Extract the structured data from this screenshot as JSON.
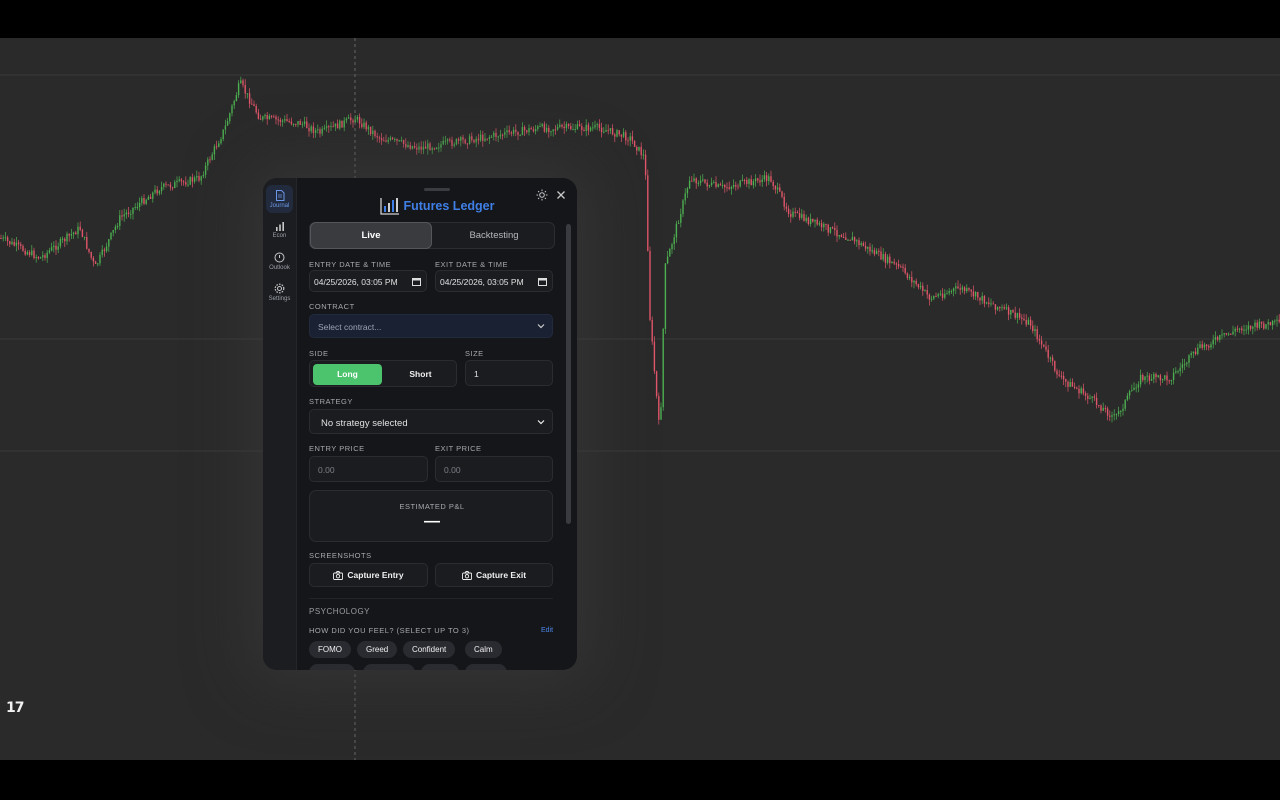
{
  "chart": {
    "logo": "17"
  },
  "panel": {
    "brand_title": "Futures Ledger",
    "sidebar": [
      {
        "label": "Journal",
        "icon": "file-text-icon",
        "active": true
      },
      {
        "label": "Econ",
        "icon": "bar-chart-icon",
        "active": false
      },
      {
        "label": "Outlook",
        "icon": "clock-icon",
        "active": false
      },
      {
        "label": "Settings",
        "icon": "gear-icon",
        "active": false
      }
    ],
    "mode_tabs": {
      "live": "Live",
      "backtesting": "Backtesting"
    },
    "entry_datetime": {
      "label": "ENTRY DATE & TIME",
      "value": "04/25/2026, 03:05 PM"
    },
    "exit_datetime": {
      "label": "EXIT DATE & TIME",
      "value": "04/25/2026, 03:05 PM"
    },
    "contract": {
      "label": "CONTRACT",
      "placeholder": "Select contract..."
    },
    "side": {
      "label": "SIDE",
      "long": "Long",
      "short": "Short"
    },
    "size": {
      "label": "SIZE",
      "value": "1"
    },
    "strategy": {
      "label": "STRATEGY",
      "value": "No strategy selected"
    },
    "entry_price": {
      "label": "ENTRY PRICE",
      "placeholder": "0.00"
    },
    "exit_price": {
      "label": "EXIT PRICE",
      "placeholder": "0.00"
    },
    "pnl": {
      "label": "ESTIMATED P&L",
      "value": "—"
    },
    "screenshots": {
      "label": "SCREENSHOTS",
      "capture_entry": "Capture Entry",
      "capture_exit": "Capture Exit"
    },
    "psychology": {
      "label": "PSYCHOLOGY",
      "question": "HOW DID YOU FEEL? (SELECT UP TO 3)",
      "edit": "Edit",
      "feelings": [
        "FOMO",
        "Greed",
        "Confident",
        "Calm"
      ]
    }
  },
  "colors": {
    "accent": "#3f7fe6",
    "long_green": "#4cc36d",
    "candle_up": "#4caf50",
    "candle_down": "#e0566a"
  }
}
